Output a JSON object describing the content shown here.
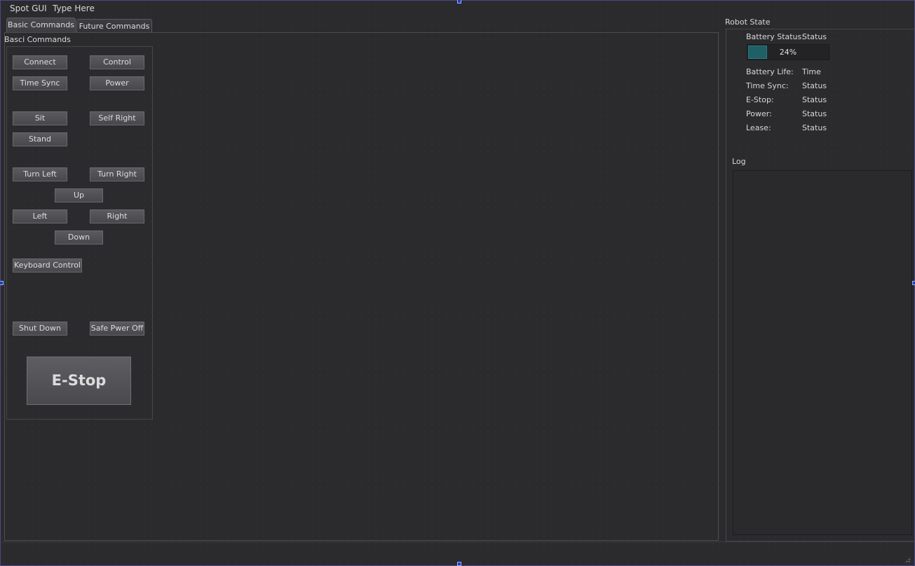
{
  "menu": {
    "items": [
      "Spot GUI",
      "Type Here"
    ]
  },
  "tabs": [
    {
      "label": "Basic Commands",
      "active": true
    },
    {
      "label": "Future Commands",
      "active": false
    }
  ],
  "basic": {
    "group_title": "Basci Commands",
    "buttons": {
      "connect": "Connect",
      "control": "Control",
      "time_sync": "Time Sync",
      "power": "Power",
      "sit": "Sit",
      "self_right": "Self Right",
      "stand": "Stand",
      "turn_left": "Turn Left",
      "turn_right": "Turn Right",
      "up": "Up",
      "left": "Left",
      "right": "Right",
      "down": "Down",
      "keyboard_control": "Keyboard Control",
      "shut_down": "Shut Down",
      "safe_power_off": "Safe Pwer Off",
      "estop": "E-Stop"
    }
  },
  "robot_state": {
    "title": "Robot State",
    "battery_status_label": "Battery Status:",
    "battery_status_value": "Status",
    "battery_percent": 24,
    "battery_percent_text": "24%",
    "rows": [
      {
        "label": "Battery Life:",
        "value": "Time"
      },
      {
        "label": "Time Sync:",
        "value": "Status"
      },
      {
        "label": "E-Stop:",
        "value": "Status"
      },
      {
        "label": "Power:",
        "value": "Status"
      },
      {
        "label": "Lease:",
        "value": "Status"
      }
    ]
  },
  "log": {
    "title": "Log"
  },
  "colors": {
    "background": "#2b2b2e",
    "progress_fill": "#1f5f66",
    "selection_handle": "#1f3fbf"
  }
}
